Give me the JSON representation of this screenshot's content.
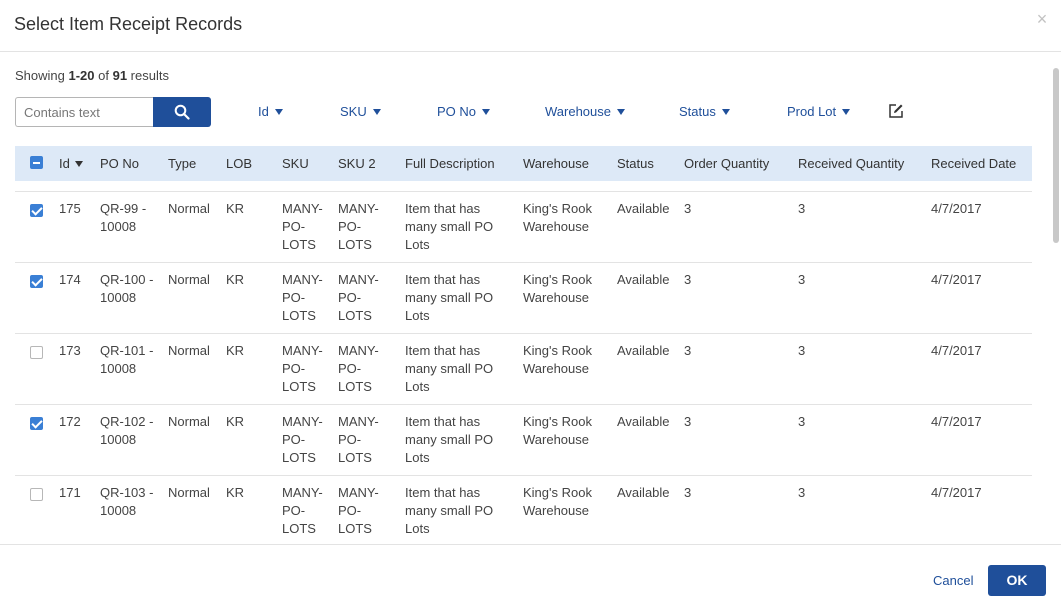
{
  "dialog": {
    "title": "Select Item Receipt Records",
    "close_icon": "close-icon"
  },
  "results": {
    "prefix": "Showing ",
    "range": "1-20",
    "of": " of ",
    "total": "91",
    "suffix": " results"
  },
  "search": {
    "placeholder": "Contains text",
    "value": "",
    "icon": "search-icon"
  },
  "filters": [
    "Id",
    "SKU",
    "PO No",
    "Warehouse",
    "Status",
    "Prod Lot"
  ],
  "columns": [
    "Id",
    "PO No",
    "Type",
    "LOB",
    "SKU",
    "SKU 2",
    "Full Description",
    "Warehouse",
    "Status",
    "Order Quantity",
    "Received Quantity",
    "Received Date"
  ],
  "select_all_state": "indeterminate",
  "rows": [
    {
      "checked": true,
      "id": "175",
      "po_no": [
        "QR-99 -",
        "10008"
      ],
      "type": "Normal",
      "lob": "KR",
      "sku": [
        "MANY-",
        "PO-",
        "LOTS"
      ],
      "sku2": [
        "MANY-",
        "PO-",
        "LOTS"
      ],
      "description": [
        "Item that has",
        "many small PO",
        "Lots"
      ],
      "warehouse": [
        "King's Rook",
        "Warehouse"
      ],
      "status": "Available",
      "order_qty": "3",
      "received_qty": "3",
      "received_date": "4/7/2017"
    },
    {
      "checked": true,
      "id": "174",
      "po_no": [
        "QR-100 -",
        "10008"
      ],
      "type": "Normal",
      "lob": "KR",
      "sku": [
        "MANY-",
        "PO-",
        "LOTS"
      ],
      "sku2": [
        "MANY-",
        "PO-",
        "LOTS"
      ],
      "description": [
        "Item that has",
        "many small PO",
        "Lots"
      ],
      "warehouse": [
        "King's Rook",
        "Warehouse"
      ],
      "status": "Available",
      "order_qty": "3",
      "received_qty": "3",
      "received_date": "4/7/2017"
    },
    {
      "checked": false,
      "id": "173",
      "po_no": [
        "QR-101 -",
        "10008"
      ],
      "type": "Normal",
      "lob": "KR",
      "sku": [
        "MANY-",
        "PO-",
        "LOTS"
      ],
      "sku2": [
        "MANY-",
        "PO-",
        "LOTS"
      ],
      "description": [
        "Item that has",
        "many small PO",
        "Lots"
      ],
      "warehouse": [
        "King's Rook",
        "Warehouse"
      ],
      "status": "Available",
      "order_qty": "3",
      "received_qty": "3",
      "received_date": "4/7/2017"
    },
    {
      "checked": true,
      "id": "172",
      "po_no": [
        "QR-102 -",
        "10008"
      ],
      "type": "Normal",
      "lob": "KR",
      "sku": [
        "MANY-",
        "PO-",
        "LOTS"
      ],
      "sku2": [
        "MANY-",
        "PO-",
        "LOTS"
      ],
      "description": [
        "Item that has",
        "many small PO",
        "Lots"
      ],
      "warehouse": [
        "King's Rook",
        "Warehouse"
      ],
      "status": "Available",
      "order_qty": "3",
      "received_qty": "3",
      "received_date": "4/7/2017"
    },
    {
      "checked": false,
      "id": "171",
      "po_no": [
        "QR-103 -",
        "10008"
      ],
      "type": "Normal",
      "lob": "KR",
      "sku": [
        "MANY-",
        "PO-",
        "LOTS"
      ],
      "sku2": [
        "MANY-",
        "PO-",
        "LOTS"
      ],
      "description": [
        "Item that has",
        "many small PO",
        "Lots"
      ],
      "warehouse": [
        "King's Rook",
        "Warehouse"
      ],
      "status": "Available",
      "order_qty": "3",
      "received_qty": "3",
      "received_date": "4/7/2017"
    }
  ],
  "footer": {
    "cancel_label": "Cancel",
    "ok_label": "OK"
  },
  "colors": {
    "primary": "#1f4f9a",
    "header_bg": "#dde9f7",
    "checkbox": "#3a7fd5"
  }
}
